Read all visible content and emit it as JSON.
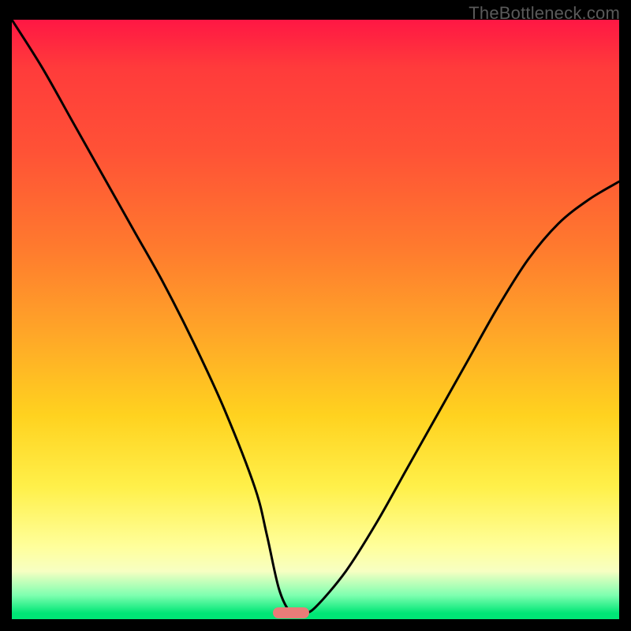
{
  "watermark": "TheBottleneck.com",
  "colors": {
    "background": "#000000",
    "gradient_top": "#ff1744",
    "gradient_mid1": "#ff7a2e",
    "gradient_mid2": "#ffd21f",
    "gradient_mid3": "#ffff9c",
    "gradient_bottom": "#00e676",
    "curve": "#000000",
    "marker": "#e97c78"
  },
  "chart_data": {
    "type": "line",
    "title": "",
    "xlabel": "",
    "ylabel": "",
    "xlim": [
      0,
      100
    ],
    "ylim": [
      0,
      100
    ],
    "series": [
      {
        "name": "bottleneck-curve",
        "x": [
          0,
          5,
          10,
          15,
          20,
          25,
          30,
          35,
          40,
          42,
          44,
          46,
          48,
          50,
          55,
          60,
          65,
          70,
          75,
          80,
          85,
          90,
          95,
          100
        ],
        "values": [
          100,
          92,
          83,
          74,
          65,
          56,
          46,
          35,
          22,
          14,
          5,
          1,
          1,
          2,
          8,
          16,
          25,
          34,
          43,
          52,
          60,
          66,
          70,
          73
        ]
      }
    ],
    "annotations": [
      {
        "name": "min-marker",
        "x": 46,
        "y": 0,
        "shape": "pill",
        "color": "#e97c78"
      }
    ],
    "background_gradient": {
      "direction": "vertical",
      "stops": [
        {
          "pos": 0.0,
          "color": "#ff1744"
        },
        {
          "pos": 0.38,
          "color": "#ff7a2e"
        },
        {
          "pos": 0.66,
          "color": "#ffd21f"
        },
        {
          "pos": 0.88,
          "color": "#ffff9c"
        },
        {
          "pos": 0.99,
          "color": "#00e676"
        }
      ]
    }
  }
}
